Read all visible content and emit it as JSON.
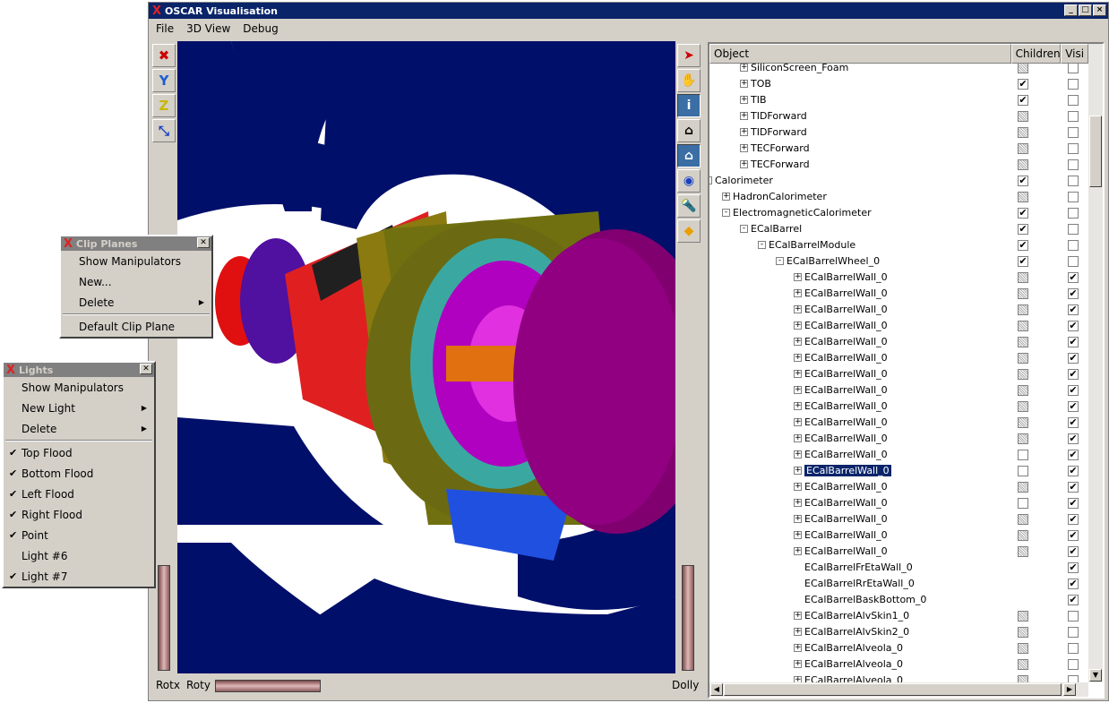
{
  "window": {
    "title": "OSCAR Visualisation",
    "controls": [
      "_",
      "□",
      "×"
    ]
  },
  "menu": [
    "File",
    "3D View",
    "Debug"
  ],
  "left_toolbar": [
    {
      "icon": "close-x-icon",
      "glyph": "✖",
      "color": "#cc0000"
    },
    {
      "icon": "y-axis-icon",
      "glyph": "Y",
      "color": "#1a5fd0"
    },
    {
      "icon": "z-axis-icon",
      "glyph": "Z",
      "color": "#c8b800"
    },
    {
      "icon": "x-axis-icon",
      "glyph": "⤡",
      "color": "#1a3fc0"
    }
  ],
  "right_toolbar": [
    {
      "icon": "pointer-arrow-icon",
      "glyph": "➤",
      "color": "#cc0000"
    },
    {
      "icon": "hand-pan-icon",
      "glyph": "✋",
      "color": "#000000"
    },
    {
      "icon": "info-icon",
      "glyph": "i",
      "color": "#ffffff"
    },
    {
      "icon": "home-icon",
      "glyph": "⌂",
      "color": "#000000"
    },
    {
      "icon": "set-home-icon",
      "glyph": "⌂",
      "color": "#ffffff"
    },
    {
      "icon": "view-all-eye-icon",
      "glyph": "◉",
      "color": "#1a3fc0"
    },
    {
      "icon": "seek-flashlight-icon",
      "glyph": "🔦",
      "color": "#808080"
    },
    {
      "icon": "perspective-cube-icon",
      "glyph": "◆",
      "color": "#e8a000"
    }
  ],
  "bottom": {
    "rotx": "Rotx",
    "roty": "Roty",
    "dolly": "Dolly"
  },
  "tree": {
    "headers": [
      "Object",
      "Children",
      "Visi"
    ],
    "rows": [
      {
        "label": "SiliconScreen_Foam",
        "level": 5,
        "ex": "+",
        "children": "grey",
        "vis": ""
      },
      {
        "label": "TOB",
        "level": 5,
        "ex": "+",
        "children": "✔",
        "vis": ""
      },
      {
        "label": "TIB",
        "level": 5,
        "ex": "+",
        "children": "✔",
        "vis": ""
      },
      {
        "label": "TIDForward",
        "level": 5,
        "ex": "+",
        "children": "grey",
        "vis": ""
      },
      {
        "label": "TIDForward",
        "level": 5,
        "ex": "+",
        "children": "grey",
        "vis": ""
      },
      {
        "label": "TECForward",
        "level": 5,
        "ex": "+",
        "children": "grey",
        "vis": ""
      },
      {
        "label": "TECForward",
        "level": 5,
        "ex": "+",
        "children": "grey",
        "vis": ""
      },
      {
        "label": "Calorimeter",
        "level": 3,
        "ex": "-",
        "children": "✔",
        "vis": ""
      },
      {
        "label": "HadronCalorimeter",
        "level": 4,
        "ex": "+",
        "children": "grey",
        "vis": ""
      },
      {
        "label": "ElectromagneticCalorimeter",
        "level": 4,
        "ex": "-",
        "children": "✔",
        "vis": ""
      },
      {
        "label": "ECalBarrel",
        "level": 5,
        "ex": "-",
        "children": "✔",
        "vis": ""
      },
      {
        "label": "ECalBarrelModule",
        "level": 6,
        "ex": "-",
        "children": "✔",
        "vis": ""
      },
      {
        "label": "ECalBarrelWheel_0",
        "level": 7,
        "ex": "-",
        "children": "✔",
        "vis": ""
      },
      {
        "label": "ECalBarrelWall_0",
        "level": 8,
        "ex": "+",
        "children": "grey",
        "vis": "✔"
      },
      {
        "label": "ECalBarrelWall_0",
        "level": 8,
        "ex": "+",
        "children": "grey",
        "vis": "✔"
      },
      {
        "label": "ECalBarrelWall_0",
        "level": 8,
        "ex": "+",
        "children": "grey",
        "vis": "✔"
      },
      {
        "label": "ECalBarrelWall_0",
        "level": 8,
        "ex": "+",
        "children": "grey",
        "vis": "✔"
      },
      {
        "label": "ECalBarrelWall_0",
        "level": 8,
        "ex": "+",
        "children": "grey",
        "vis": "✔"
      },
      {
        "label": "ECalBarrelWall_0",
        "level": 8,
        "ex": "+",
        "children": "grey",
        "vis": "✔"
      },
      {
        "label": "ECalBarrelWall_0",
        "level": 8,
        "ex": "+",
        "children": "grey",
        "vis": "✔"
      },
      {
        "label": "ECalBarrelWall_0",
        "level": 8,
        "ex": "+",
        "children": "grey",
        "vis": "✔"
      },
      {
        "label": "ECalBarrelWall_0",
        "level": 8,
        "ex": "+",
        "children": "grey",
        "vis": "✔"
      },
      {
        "label": "ECalBarrelWall_0",
        "level": 8,
        "ex": "+",
        "children": "grey",
        "vis": "✔"
      },
      {
        "label": "ECalBarrelWall_0",
        "level": 8,
        "ex": "+",
        "children": "grey",
        "vis": "✔"
      },
      {
        "label": "ECalBarrelWall_0",
        "level": 8,
        "ex": "+",
        "children": "empty",
        "vis": "✔"
      },
      {
        "label": "ECalBarrelWall_0",
        "level": 8,
        "ex": "+",
        "children": "empty",
        "vis": "✔",
        "selected": true
      },
      {
        "label": "ECalBarrelWall_0",
        "level": 8,
        "ex": "+",
        "children": "grey",
        "vis": "✔"
      },
      {
        "label": "ECalBarrelWall_0",
        "level": 8,
        "ex": "+",
        "children": "empty",
        "vis": "✔"
      },
      {
        "label": "ECalBarrelWall_0",
        "level": 8,
        "ex": "+",
        "children": "grey",
        "vis": "✔"
      },
      {
        "label": "ECalBarrelWall_0",
        "level": 8,
        "ex": "+",
        "children": "grey",
        "vis": "✔"
      },
      {
        "label": "ECalBarrelWall_0",
        "level": 8,
        "ex": "+",
        "children": "grey",
        "vis": "✔"
      },
      {
        "label": "ECalBarrelFrEtaWall_0",
        "level": 8,
        "ex": "",
        "children": "",
        "vis": "✔"
      },
      {
        "label": "ECalBarrelRrEtaWall_0",
        "level": 8,
        "ex": "",
        "children": "",
        "vis": "✔"
      },
      {
        "label": "ECalBarrelBaskBottom_0",
        "level": 8,
        "ex": "",
        "children": "",
        "vis": "✔"
      },
      {
        "label": "ECalBarrelAlvSkin1_0",
        "level": 8,
        "ex": "+",
        "children": "grey",
        "vis": ""
      },
      {
        "label": "ECalBarrelAlvSkin2_0",
        "level": 8,
        "ex": "+",
        "children": "grey",
        "vis": ""
      },
      {
        "label": "ECalBarrelAlveola_0",
        "level": 8,
        "ex": "+",
        "children": "grey",
        "vis": ""
      },
      {
        "label": "ECalBarrelAlveola_0",
        "level": 8,
        "ex": "+",
        "children": "grey",
        "vis": ""
      },
      {
        "label": "ECalBarrelAlveola_0",
        "level": 8,
        "ex": "+",
        "children": "grey",
        "vis": ""
      }
    ]
  },
  "clip_planes": {
    "title": "Clip Planes",
    "items": [
      {
        "label": "Show Manipulators"
      },
      {
        "label": "New..."
      },
      {
        "label": "Delete",
        "sub": true
      },
      {
        "sep": true
      },
      {
        "label": "Default Clip Plane"
      }
    ]
  },
  "lights": {
    "title": "Lights",
    "items": [
      {
        "label": "Show Manipulators"
      },
      {
        "label": "New Light",
        "sub": true
      },
      {
        "label": "Delete",
        "sub": true
      },
      {
        "sep": true
      },
      {
        "label": "Top Flood",
        "checked": true
      },
      {
        "label": "Bottom Flood",
        "checked": true
      },
      {
        "label": "Left Flood",
        "checked": true
      },
      {
        "label": "Right Flood",
        "checked": true
      },
      {
        "label": "Point",
        "checked": true
      },
      {
        "label": "Light #6",
        "checked": false
      },
      {
        "label": "Light #7",
        "checked": true
      }
    ]
  }
}
